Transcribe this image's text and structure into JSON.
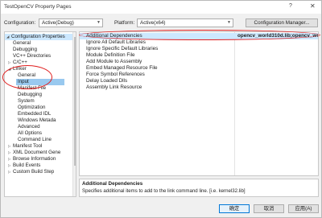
{
  "window": {
    "title": "TestOpenCV Property Pages",
    "help_glyph": "?",
    "close_glyph": "✕"
  },
  "config": {
    "configuration_label": "Configuration:",
    "configuration_value": "Active(Debug)",
    "platform_label": "Platform:",
    "platform_value": "Active(x64)",
    "manager_button": "Configuration Manager..."
  },
  "tree": {
    "items": [
      {
        "label": "Configuration Properties",
        "toggle": "◢"
      },
      {
        "label": "General",
        "toggle": ""
      },
      {
        "label": "Debugging",
        "toggle": ""
      },
      {
        "label": "VC++ Directories",
        "toggle": ""
      },
      {
        "label": "C/C++",
        "toggle": "▷"
      },
      {
        "label": "Linker",
        "toggle": "◢"
      },
      {
        "label": "General",
        "toggle": ""
      },
      {
        "label": "Input",
        "toggle": ""
      },
      {
        "label": "Manifest File",
        "toggle": ""
      },
      {
        "label": "Debugging",
        "toggle": ""
      },
      {
        "label": "System",
        "toggle": ""
      },
      {
        "label": "Optimization",
        "toggle": ""
      },
      {
        "label": "Embedded IDL",
        "toggle": ""
      },
      {
        "label": "Windows Metada",
        "toggle": ""
      },
      {
        "label": "Advanced",
        "toggle": ""
      },
      {
        "label": "All Options",
        "toggle": ""
      },
      {
        "label": "Command Line",
        "toggle": ""
      },
      {
        "label": "Manifest Tool",
        "toggle": "▷"
      },
      {
        "label": "XML Document Gene",
        "toggle": "▷"
      },
      {
        "label": "Browse Information",
        "toggle": "▷"
      },
      {
        "label": "Build Events",
        "toggle": "▷"
      },
      {
        "label": "Custom Build Step",
        "toggle": "▷"
      }
    ]
  },
  "properties": {
    "rows": [
      {
        "name": "Additional Dependencies",
        "value": "opencv_world310d.lib;opencv_world310.lib;%(AdditionalDepe"
      },
      {
        "name": "Ignore All Default Libraries",
        "value": ""
      },
      {
        "name": "Ignore Specific Default Libraries",
        "value": ""
      },
      {
        "name": "Module Definition File",
        "value": ""
      },
      {
        "name": "Add Module to Assembly",
        "value": ""
      },
      {
        "name": "Embed Managed Resource File",
        "value": ""
      },
      {
        "name": "Force Symbol References",
        "value": ""
      },
      {
        "name": "Delay Loaded Dlls",
        "value": ""
      },
      {
        "name": "Assembly Link Resource",
        "value": ""
      }
    ]
  },
  "description": {
    "title": "Additional Dependencies",
    "text": "Specifies additional items to add to the link command line. [i.e. kernel32.lib]"
  },
  "buttons": {
    "ok": "确定",
    "cancel": "取消",
    "apply": "应用(A)"
  },
  "colors": {
    "selection": "#cce8ff",
    "annotation": "#e02020"
  }
}
